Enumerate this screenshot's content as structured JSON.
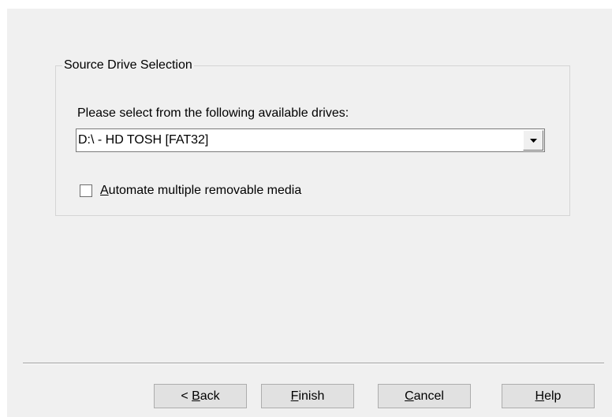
{
  "source_group": {
    "title": "Source Drive Selection",
    "prompt": "Please select from the following available drives:",
    "drive_select": {
      "selected": "D:\\ - HD TOSH [FAT32]",
      "dropdown_icon": "chevron-down-icon"
    },
    "automate_checkbox": {
      "checked": false,
      "accel": "A",
      "label_rest": "utomate multiple removable media"
    }
  },
  "buttons": {
    "back": {
      "prefix": "< ",
      "accel": "B",
      "rest": "ack"
    },
    "finish": {
      "prefix": "",
      "accel": "F",
      "rest": "inish"
    },
    "cancel": {
      "prefix": "",
      "accel": "C",
      "rest": "ancel"
    },
    "help": {
      "prefix": "",
      "accel": "H",
      "rest": "elp"
    }
  }
}
